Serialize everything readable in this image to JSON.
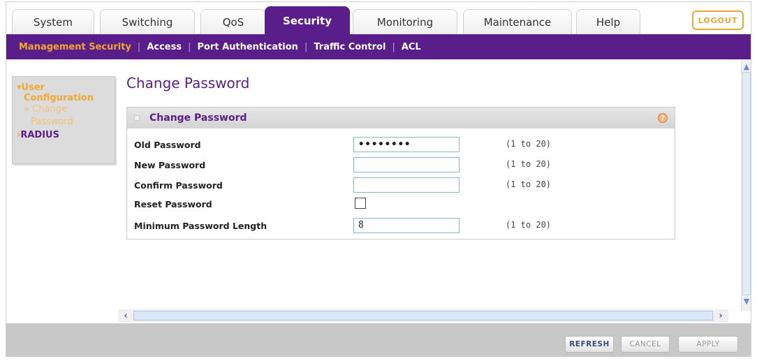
{
  "tabs": [
    {
      "label": "System"
    },
    {
      "label": "Switching"
    },
    {
      "label": "QoS"
    },
    {
      "label": "Security"
    },
    {
      "label": "Monitoring"
    },
    {
      "label": "Maintenance"
    },
    {
      "label": "Help"
    }
  ],
  "active_tab": "Security",
  "logout_label": "LOGOUT",
  "subnav": [
    {
      "label": "Management Security"
    },
    {
      "label": "Access"
    },
    {
      "label": "Port Authentication"
    },
    {
      "label": "Traffic Control"
    },
    {
      "label": "ACL"
    }
  ],
  "sidebar": {
    "user": "User",
    "configuration": "Configuration",
    "change_password_line1": "» Change",
    "change_password_line2": "Password",
    "radius": "RADIUS"
  },
  "page_title": "Change Password",
  "panel": {
    "title": "Change Password",
    "help": "?",
    "rows": [
      {
        "label": "Old Password",
        "value": "••••••••",
        "range": "(1 to 20)"
      },
      {
        "label": "New Password",
        "value": "",
        "range": "(1 to 20)"
      },
      {
        "label": "Confirm Password",
        "value": "",
        "range": "(1 to 20)"
      },
      {
        "label": "Reset Password",
        "checked": false
      },
      {
        "label": "Minimum Password Length",
        "value": "8",
        "range": "(1 to 20)"
      }
    ]
  },
  "footer": {
    "refresh": "REFRESH",
    "cancel": "CANCEL",
    "apply": "APPLY"
  },
  "colors": {
    "brand_purple": "#5a1e8a",
    "accent_orange": "#f0a830"
  },
  "icons": {
    "help": "help-icon",
    "scroll_up": "arrow-up-icon",
    "scroll_down": "arrow-down-icon",
    "scroll_left": "arrow-left-icon",
    "scroll_right": "arrow-right-icon"
  }
}
